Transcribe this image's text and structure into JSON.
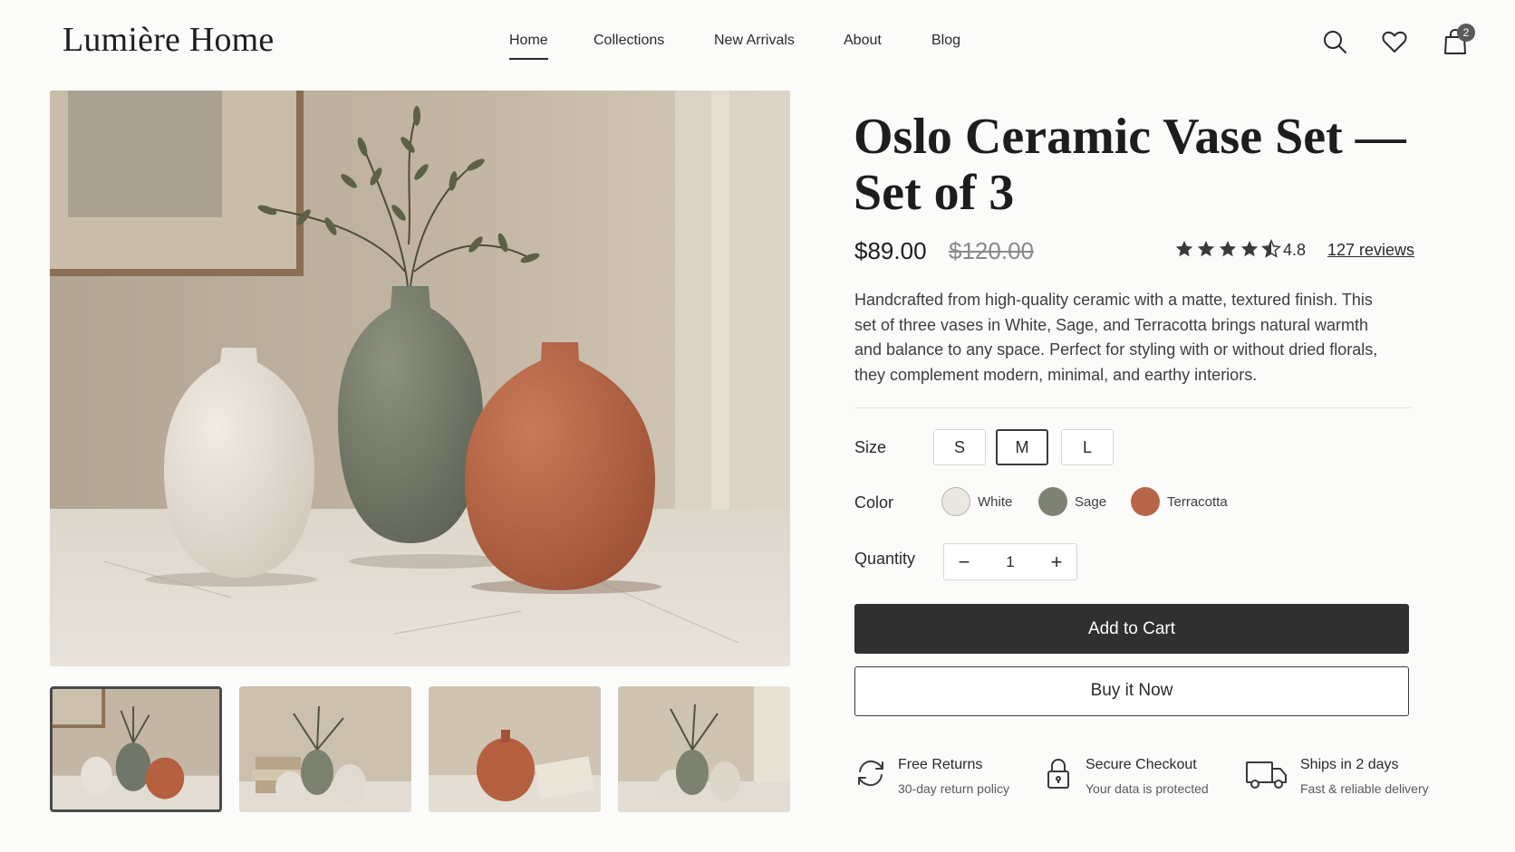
{
  "header": {
    "logo": "Lumière Home",
    "nav": [
      {
        "label": "Home",
        "active": true
      },
      {
        "label": "Collections",
        "active": false
      },
      {
        "label": "New Arrivals",
        "active": false
      },
      {
        "label": "About",
        "active": false
      },
      {
        "label": "Blog",
        "active": false
      }
    ],
    "icons": [
      "search-icon",
      "heart-icon",
      "shopping-bag-icon"
    ],
    "cart_count": "2"
  },
  "product": {
    "title": "Oslo Ceramic Vase Set — Set of 3",
    "price": "$89.00",
    "price_original": "$120.00",
    "rating": "4.8",
    "rating_value": 4.5,
    "reviews": "127 reviews",
    "description": "Handcrafted from high-quality ceramic with a matte, textured finish. This set of three vases in White, Sage, and Terracotta brings natural warmth and balance to any space. Perfect for styling with or without dried florals, they complement modern, minimal, and earthy interiors."
  },
  "options": {
    "size_label": "Size",
    "sizes": [
      "S",
      "M",
      "L"
    ],
    "selected_size": "M",
    "color_label": "Color",
    "colors": [
      {
        "name": "White",
        "hex": "#ebe8e2"
      },
      {
        "name": "Sage",
        "hex": "#7d8272"
      },
      {
        "name": "Terracotta",
        "hex": "#b8664a"
      }
    ],
    "quantity_label": "Quantity",
    "quantity": "1",
    "minus": "−",
    "plus": "+"
  },
  "actions": {
    "add_to_cart": "Add to Cart",
    "buy_now": "Buy it Now"
  },
  "features": [
    {
      "icon": "refresh-icon",
      "title": "Free Returns",
      "subtitle": "30-day return policy"
    },
    {
      "icon": "lock-icon",
      "title": "Secure Checkout",
      "subtitle": "Your data is protected"
    },
    {
      "icon": "truck-icon",
      "title": "Ships in 2 days",
      "subtitle": "Fast & reliable delivery"
    }
  ],
  "gallery": {
    "selected_index": 0,
    "thumbnail_count": 4
  },
  "colors": {
    "dark_button": "#303030",
    "accent_text": "#1d1d1d"
  }
}
